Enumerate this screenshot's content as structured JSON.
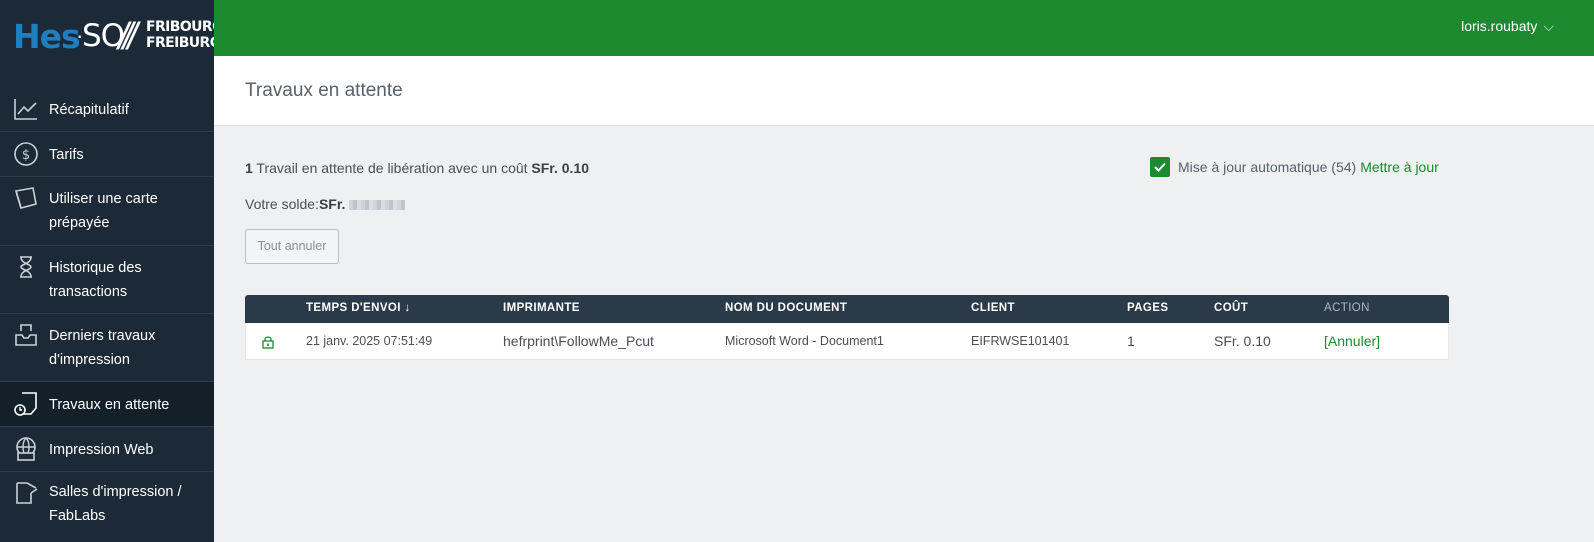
{
  "logo": {
    "hes": "Hes",
    "dot": "·",
    "so": "SO",
    "slashes": "///",
    "city_fr": "FRIBOURG",
    "city_de": "FREIBURG"
  },
  "sidebar": {
    "items": [
      {
        "label": "Récapitulatif",
        "icon": "chart-line-icon"
      },
      {
        "label": "Tarifs",
        "icon": "dollar-circle-icon"
      },
      {
        "label": "Utiliser une carte prépayée",
        "icon": "card-icon"
      },
      {
        "label": "Historique des transactions",
        "icon": "hourglass-icon"
      },
      {
        "label": "Derniers travaux d'impression",
        "icon": "inbox-icon"
      },
      {
        "label": "Travaux en attente",
        "icon": "pending-print-icon"
      },
      {
        "label": "Impression Web",
        "icon": "web-print-icon"
      },
      {
        "label": "Salles d'impression / FabLabs",
        "icon": "printer-room-icon"
      }
    ],
    "active_index": 5
  },
  "header": {
    "username": "loris.roubaty",
    "chevron": "⌵"
  },
  "page": {
    "title": "Travaux en attente"
  },
  "summary": {
    "count": "1",
    "text": " Travail en attente de libération avec un coût ",
    "amount": "SFr. 0.10",
    "balance_label": "Votre solde:",
    "balance_currency": "SFr."
  },
  "actions": {
    "cancel_all": "Tout annuler"
  },
  "auto_update": {
    "label": "Mise à jour automatique (54)",
    "checked": true,
    "refresh_link": "Mettre à jour"
  },
  "table": {
    "columns": [
      "TEMPS D'ENVOI",
      "IMPRIMANTE",
      "NOM DU DOCUMENT",
      "CLIENT",
      "PAGES",
      "COÛT",
      "ACTION"
    ],
    "sort_indicator": "↓",
    "rows": [
      {
        "time": "21 janv. 2025 07:51:49",
        "printer": "hefrprint\\FollowMe_Pcut",
        "document": "Microsoft Word - Document1",
        "client": "EIFRWSE101401",
        "pages": "1",
        "cost": "SFr. 0.10",
        "action": "[Annuler]"
      }
    ]
  },
  "colors": {
    "accent": "#1d8a30",
    "sidebar": "#1b2a36",
    "table_header": "#2b3a48",
    "logo_blue": "#1e7fc0"
  }
}
